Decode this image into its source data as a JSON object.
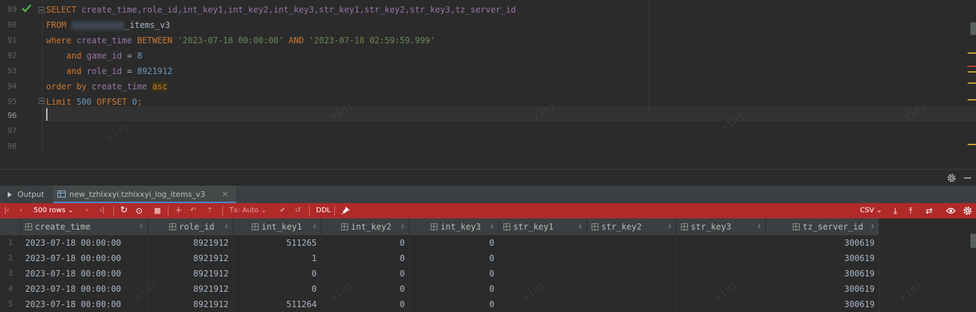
{
  "editor": {
    "line_numbers": [
      "89",
      "90",
      "91",
      "92",
      "93",
      "94",
      "95",
      "96",
      "97",
      "98"
    ],
    "sql": {
      "l89": {
        "kw": "SELECT",
        "cols": " create_time,role_id,int_key1,int_key2,int_key3,str_key1,str_key2,str_key3,tz_server_id"
      },
      "l90": {
        "kw": "FROM",
        "table_suffix": "_items_v3"
      },
      "l91": {
        "kw1": "where",
        "col": "create_time",
        "kw2": "BETWEEN",
        "v1": "'2023-07-18 00:00:00'",
        "kw3": "AND",
        "v2": "'2023-07-18 02:59:59.999'"
      },
      "l92": {
        "kw": "and",
        "col": "game_id",
        "op": "=",
        "val": "8"
      },
      "l93": {
        "kw": "and",
        "col": "role_id",
        "op": "=",
        "val": "8921912"
      },
      "l94": {
        "kw1": "order by",
        "col": "create_time",
        "kw2": "asc"
      },
      "l95": {
        "kw1": "Limit",
        "v1": "500",
        "kw2": "OFFSET",
        "v2": "0",
        "end": ";"
      }
    },
    "watermark": "xin)"
  },
  "panel": {
    "tab_output": "Output",
    "tab_table": "new_tzhlxxyi.tzhlxxyi_log_items_v3"
  },
  "toolbar": {
    "rows_label": "500 rows",
    "tx_label": "Tx: Auto",
    "ddl_label": "DDL",
    "csv_label": "CSV"
  },
  "grid": {
    "columns": [
      "create_time",
      "role_id",
      "int_key1",
      "int_key2",
      "int_key3",
      "str_key1",
      "str_key2",
      "str_key3",
      "tz_server_id"
    ],
    "rows": [
      [
        "1",
        "2023-07-18 00:00:00",
        "8921912",
        "511265",
        "0",
        "0",
        "",
        "",
        "",
        "300619"
      ],
      [
        "2",
        "2023-07-18 00:00:00",
        "8921912",
        "1",
        "0",
        "0",
        "",
        "",
        "",
        "300619"
      ],
      [
        "3",
        "2023-07-18 00:00:00",
        "8921912",
        "0",
        "0",
        "0",
        "",
        "",
        "",
        "300619"
      ],
      [
        "4",
        "2023-07-18 00:00:00",
        "8921912",
        "0",
        "0",
        "0",
        "",
        "",
        "",
        "300619"
      ],
      [
        "5",
        "2023-07-18 00:00:00",
        "8921912",
        "511264",
        "0",
        "0",
        "",
        "",
        "",
        "300619"
      ]
    ]
  },
  "icons": {
    "check": "check-icon",
    "settings": "gear-icon",
    "minimize": "minimize-icon"
  }
}
